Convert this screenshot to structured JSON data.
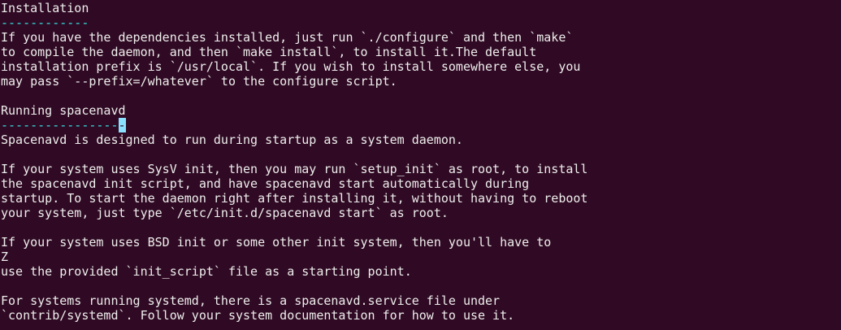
{
  "theme": {
    "background": "#300a24",
    "foreground": "#eeeeec",
    "underline_color": "#34e2e2",
    "cursor_color": "#8ae0ff"
  },
  "editor": {
    "lines": [
      "Installation",
      "------------",
      "If you have the dependencies installed, just run `./configure` and then `make`",
      "to compile the daemon, and then `make install`, to install it.The default",
      "installation prefix is `/usr/local`. If you wish to install somewhere else, you",
      "may pass `--prefix=/whatever` to the configure script.",
      "",
      "Running spacenavd",
      "----------------",
      "Spacenavd is designed to run during startup as a system daemon.",
      "",
      "If your system uses SysV init, then you may run `setup_init` as root, to install",
      "the spacenavd init script, and have spacenavd start automatically during",
      "startup. To start the daemon right after installing it, without having to reboot",
      "your system, just type `/etc/init.d/spacenavd start` as root.",
      "",
      "If your system uses BSD init or some other init system, then you'll have to",
      "Z",
      "use the provided `init_script` file as a starting point.",
      "",
      "For systems running systemd, there is a spacenavd.service file under",
      "`contrib/systemd`. Follow your system documentation for how to use it."
    ],
    "cursor_char": "-"
  }
}
